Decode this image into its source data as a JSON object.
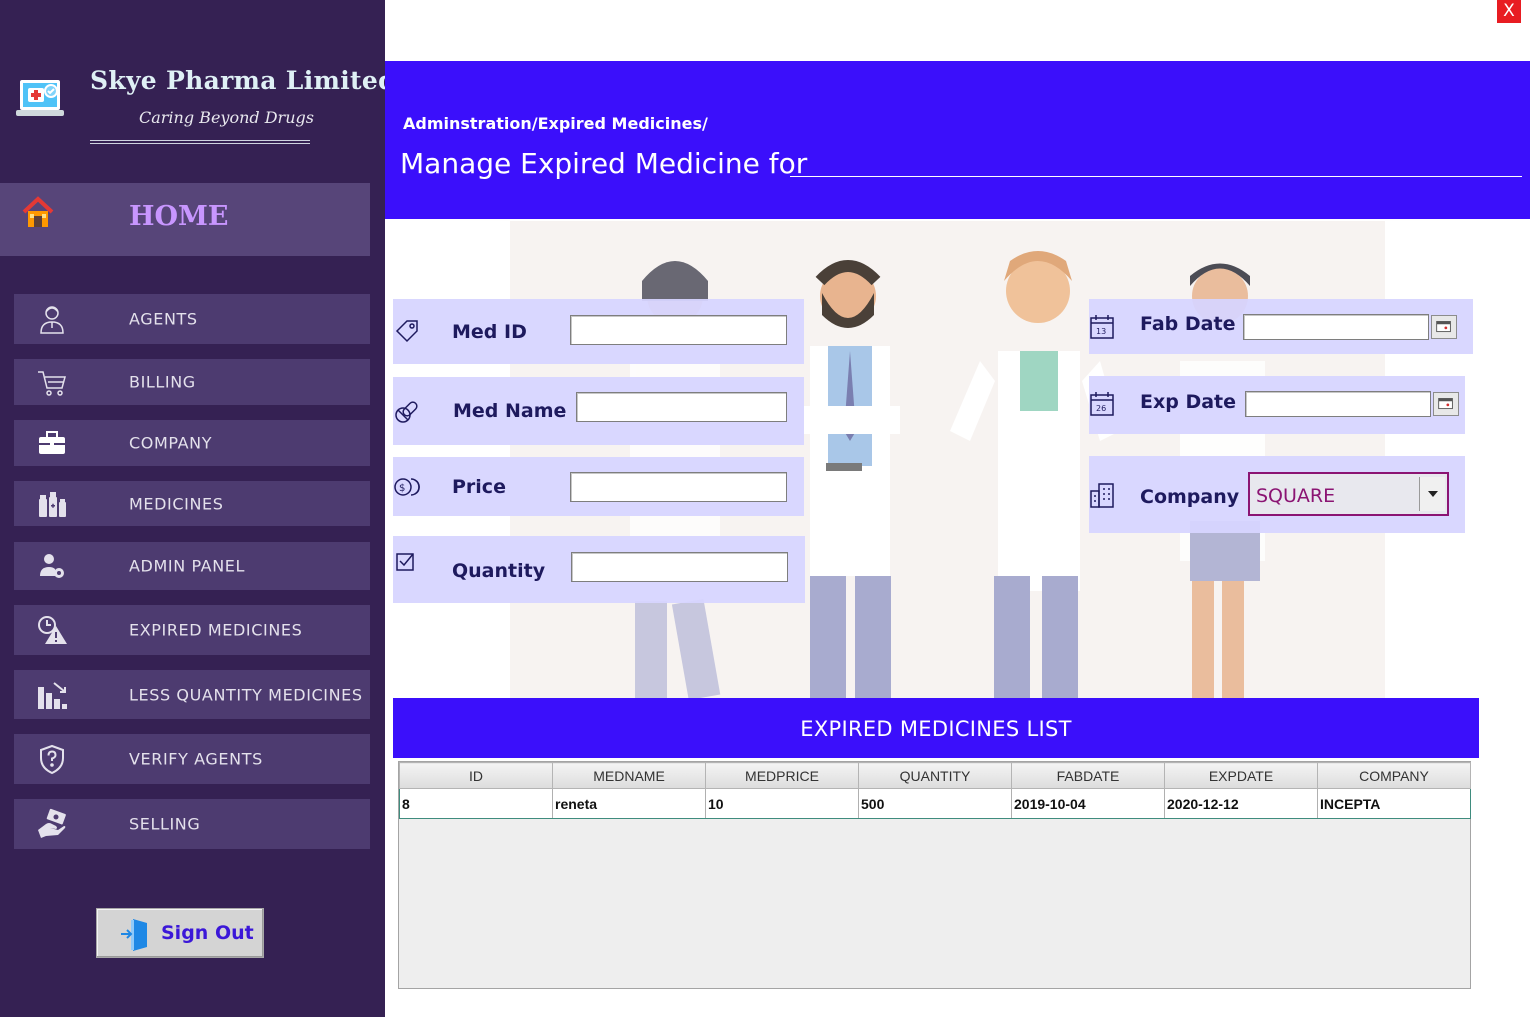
{
  "window": {
    "close_label": "X"
  },
  "brand": {
    "name": "Skye Pharma Limited",
    "tagline": "Caring Beyond Drugs"
  },
  "sidebar": {
    "home": {
      "label": "HOME",
      "icon": "home-icon"
    },
    "items": [
      {
        "label": "AGENTS",
        "icon": "agent-icon"
      },
      {
        "label": "BILLING",
        "icon": "cart-icon"
      },
      {
        "label": "COMPANY",
        "icon": "briefcase-icon"
      },
      {
        "label": "MEDICINES",
        "icon": "medicine-bottles-icon"
      },
      {
        "label": "ADMIN PANEL",
        "icon": "admin-gear-icon"
      },
      {
        "label": "EXPIRED MEDICINES",
        "icon": "warning-clock-icon"
      },
      {
        "label": "LESS QUANTITY MEDICINES",
        "icon": "bar-chart-down-icon"
      },
      {
        "label": "VERIFY AGENTS",
        "icon": "shield-question-icon"
      },
      {
        "label": "SELLING",
        "icon": "hand-money-icon"
      }
    ],
    "signout_label": "Sign Out"
  },
  "header": {
    "breadcrumb": "Adminstration/Expired Medicines/",
    "title": "Manage Expired Medicine for"
  },
  "form": {
    "med_id": {
      "label": "Med ID",
      "value": ""
    },
    "med_name": {
      "label": "Med Name",
      "value": ""
    },
    "price": {
      "label": "Price",
      "value": ""
    },
    "quantity": {
      "label": "Quantity",
      "value": ""
    },
    "fab_date": {
      "label": "Fab Date",
      "value": ""
    },
    "exp_date": {
      "label": "Exp Date",
      "value": ""
    },
    "company": {
      "label": "Company",
      "value": "SQUARE"
    }
  },
  "list": {
    "title": "EXPIRED MEDICINES LIST",
    "columns": [
      "ID",
      "MEDNAME",
      "MEDPRICE",
      "QUANTITY",
      "FABDATE",
      "EXPDATE",
      "COMPANY"
    ],
    "rows": [
      [
        "8",
        "reneta",
        "10",
        "500",
        "2019-10-04",
        "2020-12-12",
        "INCEPTA"
      ]
    ]
  },
  "colors": {
    "sidebar_bg": "#352153",
    "accent_blue": "#3b0ffb",
    "home_label": "#c896ff",
    "close_red": "#e81c22",
    "company_value": "#8b1473"
  }
}
